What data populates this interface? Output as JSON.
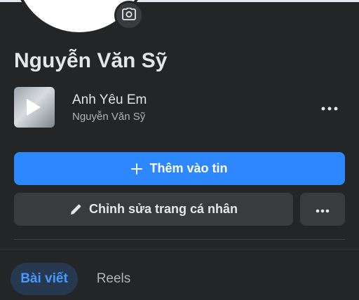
{
  "profile": {
    "name": "Nguyễn Văn Sỹ",
    "camera_icon": "camera-icon"
  },
  "music": {
    "title": "Anh Yêu Em",
    "artist": "Nguyễn Văn Sỹ",
    "more_icon": "more-horizontal-icon"
  },
  "actions": {
    "add_story_label": "Thêm vào tin",
    "add_icon": "plus-icon",
    "edit_profile_label": "Chỉnh sửa trang cá nhân",
    "edit_icon": "pencil-icon",
    "more_icon": "more-horizontal-icon"
  },
  "tabs": [
    {
      "label": "Bài viết",
      "active": true
    },
    {
      "label": "Reels",
      "active": false
    }
  ],
  "colors": {
    "background": "#242526",
    "primary": "#2d88ff",
    "secondary_button": "#3a3b3c",
    "active_tab_bg": "#263951",
    "active_tab_text": "#4599ff"
  }
}
